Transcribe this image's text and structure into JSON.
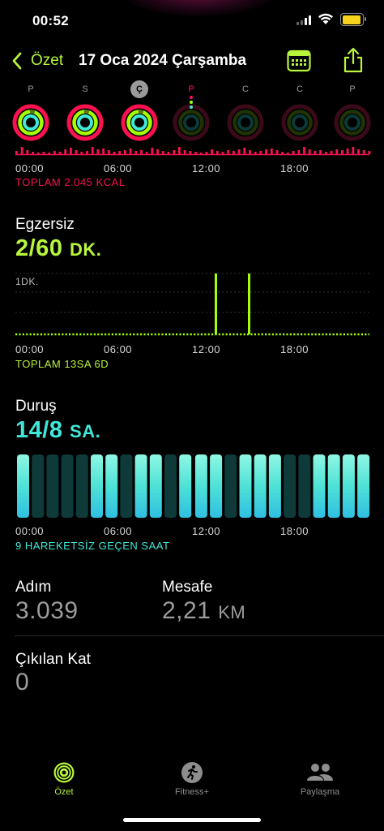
{
  "status": {
    "time": "00:52"
  },
  "nav": {
    "back_label": "Özet",
    "title": "17 Oca 2024 Çarşamba"
  },
  "week": {
    "days": [
      "P",
      "S",
      "Ç",
      "P",
      "C",
      "C",
      "P"
    ]
  },
  "move": {
    "times": [
      "00:00",
      "06:00",
      "12:00",
      "18:00"
    ],
    "total": "TOPLAM 2.045 KCAL"
  },
  "exercise": {
    "title": "Egzersiz",
    "value": "2/60",
    "unit": "DK.",
    "ytick": "1DK.",
    "times": [
      "00:00",
      "06:00",
      "12:00",
      "18:00"
    ],
    "total": "TOPLAM 13SA 6D"
  },
  "stand": {
    "title": "Duruş",
    "value": "14/8",
    "unit": "SA.",
    "times": [
      "00:00",
      "06:00",
      "12:00",
      "18:00"
    ],
    "note": "9 HAREKETSİZ GEÇEN SAAT",
    "hours_active": [
      1,
      0,
      0,
      0,
      0,
      1,
      1,
      0,
      1,
      1,
      0,
      1,
      1,
      1,
      0,
      1,
      1,
      1,
      0,
      0,
      1,
      1,
      1,
      1
    ]
  },
  "steps": {
    "label": "Adım",
    "value": "3.039"
  },
  "distance": {
    "label": "Mesafe",
    "value": "2,21",
    "unit": "KM"
  },
  "floors": {
    "label": "Çıkılan Kat",
    "value": "0"
  },
  "tabs": [
    {
      "label": "Özet"
    },
    {
      "label": "Fitness+"
    },
    {
      "label": "Paylaşma"
    }
  ],
  "colors": {
    "move": "#fa114f",
    "exercise": "#a6ff00",
    "stand": "#40e8d8",
    "accent": "#b7f63b"
  }
}
